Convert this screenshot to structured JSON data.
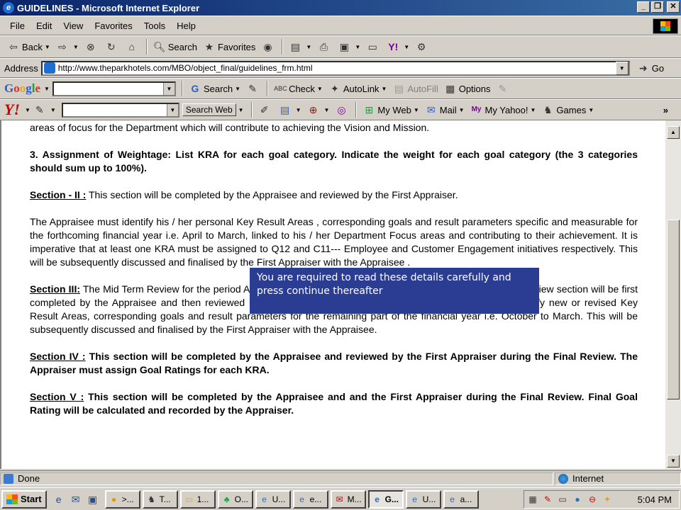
{
  "window": {
    "title": "GUIDELINES - Microsoft Internet Explorer"
  },
  "menu": [
    "File",
    "Edit",
    "View",
    "Favorites",
    "Tools",
    "Help"
  ],
  "toolbar": {
    "back": "Back",
    "search": "Search",
    "favorites": "Favorites"
  },
  "address": {
    "label": "Address",
    "url": "http://www.theparkhotels.com/MBO/object_final/guidelines_frm.html",
    "go": "Go"
  },
  "googlebar": {
    "search": "Search",
    "check": "Check",
    "autolink": "AutoLink",
    "autofill": "AutoFill",
    "options": "Options"
  },
  "yahoobar": {
    "search_web": "Search Web",
    "my_web": "My Web",
    "mail": "Mail",
    "my_yahoo": "My Yahoo!",
    "games": "Games"
  },
  "content": {
    "line0": "areas of focus for the Department which will contribute to achieving the Vision and Mission.",
    "point3": "3. Assignment of Weightage: List KRA for each goal category. Indicate the weight for each goal category (the 3 categories should sum up to 100%).",
    "s2_title": "Section - II :",
    "s2_text": " This section will be completed by the Appraisee and reviewed by the First Appraiser.",
    "s2_para": "The Appraisee must identify his / her personal Key Result Areas , corresponding goals and result parameters specific and measurable for the forthcoming financial year i.e. April to March, linked to his / her Department Focus areas and contributing to their achievement. It is imperative that at least one KRA must be assigned to Q12 and C11--- Employee and Customer Engagement initiatives respectively. This will be subsequently discussed and finalised by the First Appraiser with the Appraisee .",
    "s3_title": "Section III:",
    "s3_text": " The Mid Term Review for the period April to September will be conducted in October. The Mid-term Review section will be first completed by the Appraisee and then reviewed by the First Appraiser. In this section, the Appraisee may identify new or revised Key Result Areas, corresponding goals and result parameters for the remaining part of the financial year i.e. October to March. This will be subsequently discussed and finalised by the First Appraiser with the Appraisee.",
    "s4_title": "Section IV :",
    "s4_text": " This section will be completed by the Appraisee and reviewed by the First Appraiser during the Final Review. The Appraiser must assign Goal Ratings for each KRA.",
    "s5_title": "Section V :",
    "s5_text": " This section will be completed by the Appraisee and and the First Appraiser during the Final Review. Final Goal Rating will be calculated and recorded by the Appraiser."
  },
  "notice": {
    "text": "You are required to read these details carefully and press  continue thereafter"
  },
  "status": {
    "left": "Done",
    "zone": "Internet"
  },
  "taskbar": {
    "start": "Start",
    "tasks": [
      ">...",
      "T...",
      "1...",
      "O...",
      "U...",
      "e...",
      "M...",
      "G...",
      "U...",
      "a..."
    ],
    "clock": "5:04 PM"
  }
}
